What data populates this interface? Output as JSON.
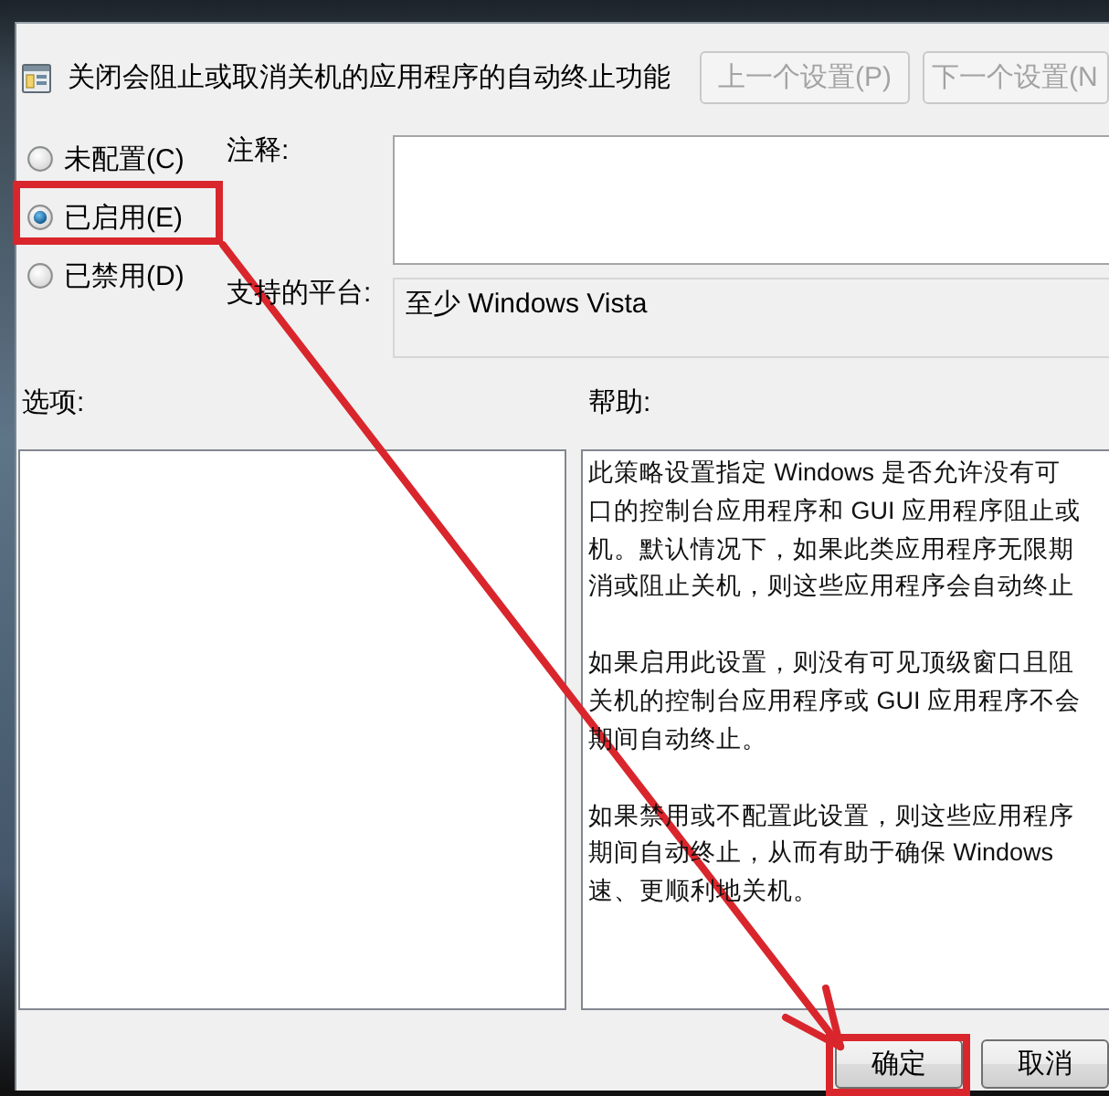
{
  "header": {
    "title": "关闭会阻止或取消关机的应用程序的自动终止功能",
    "nav_buttons": [
      {
        "label": "上一个设置(P)",
        "disabled": true
      },
      {
        "label": "下一个设置(N",
        "disabled": true
      }
    ]
  },
  "policy_state": [
    {
      "label": "未配置(C)",
      "selected": false
    },
    {
      "label": "已启用(E)",
      "selected": true
    },
    {
      "label": "已禁用(D)",
      "selected": false
    }
  ],
  "comment": {
    "label": "注释:"
  },
  "supported_on": {
    "label": "支持的平台:",
    "value": "至少 Windows Vista"
  },
  "options": {
    "label": "选项:"
  },
  "help": {
    "label": "帮助:",
    "paragraphs": [
      [
        "此策略设置指定 Windows 是否允许没有可",
        "口的控制台应用程序和 GUI 应用程序阻止或",
        "机。默认情况下，如果此类应用程序无限期",
        "消或阻止关机，则这些应用程序会自动终止"
      ],
      [
        "如果启用此设置，则没有可见顶级窗口且阻",
        "关机的控制台应用程序或 GUI 应用程序不会",
        "期间自动终止。"
      ],
      [
        "如果禁用或不配置此设置，则这些应用程序",
        "期间自动终止，从而有助于确保 Windows",
        "速、更顺利地关机。"
      ]
    ]
  },
  "buttons": [
    {
      "label": "确定"
    },
    {
      "label": "取消"
    }
  ]
}
